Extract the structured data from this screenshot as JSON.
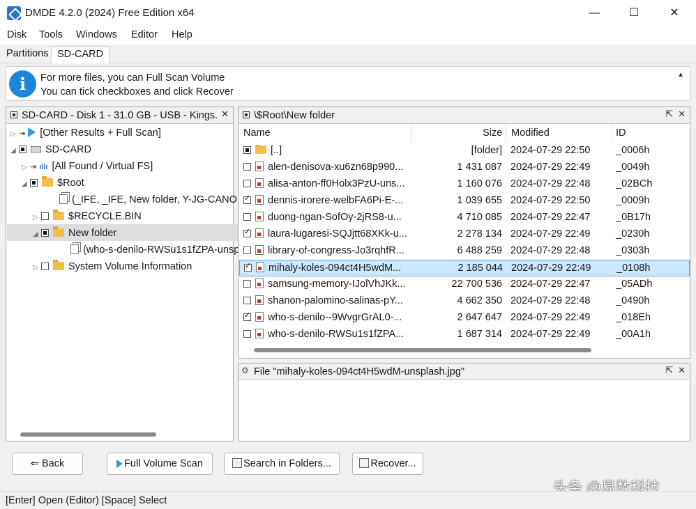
{
  "window": {
    "title": "DMDE 4.2.0 (2024) Free Edition x64",
    "controls": {
      "minimize": "—",
      "maximize": "☐",
      "close": "✕"
    }
  },
  "menu": [
    "Disk",
    "Tools",
    "Windows",
    "Editor",
    "Help"
  ],
  "tabs": [
    {
      "label": "Partitions",
      "active": false
    },
    {
      "label": "SD-CARD",
      "active": true
    }
  ],
  "info": {
    "line1": "For more files, you can Full Scan Volume",
    "line2": "You can tick checkboxes and click Recover",
    "icon": "i"
  },
  "tree_panel": {
    "title": "SD-CARD - Disk 1 - 31.0 GB - USB - Kings...",
    "items": [
      {
        "label": "[Other Results + Full Scan]",
        "icon": "play-icon"
      },
      {
        "label": "SD-CARD",
        "icon": "drive-icon"
      },
      {
        "label": "[All Found / Virtual FS]",
        "icon": "virtual-fs-icon"
      },
      {
        "label": "$Root",
        "icon": "folder-icon"
      },
      {
        "label": "(_IFE, _IFE, New folder, Y-JG-CANON",
        "icon": "copy-icon"
      },
      {
        "label": "$RECYCLE.BIN",
        "icon": "folder-icon"
      },
      {
        "label": "New folder",
        "icon": "folder-icon",
        "selected": true
      },
      {
        "label": "(who-s-denilo-RWSu1s1fZPA-unsp",
        "icon": "copy-icon"
      },
      {
        "label": "System Volume Information",
        "icon": "folder-icon"
      }
    ]
  },
  "file_panel": {
    "path": "\\$Root\\New folder",
    "columns": {
      "name": "Name",
      "size": "Size",
      "modified": "Modified",
      "id": "ID"
    },
    "rows": [
      {
        "name": "[..]",
        "size": "[folder]",
        "modified": "2024-07-29 22:50",
        "id": "_0006h",
        "check": "partial",
        "icon": "folder-icon"
      },
      {
        "name": "alen-denisova-xu6zn68p990...",
        "size": "1 431 087",
        "modified": "2024-07-29 22:49",
        "id": "_0049h",
        "check": "none",
        "icon": "image-file-icon"
      },
      {
        "name": "alisa-anton-ff0Holx3PzU-uns...",
        "size": "1 160 076",
        "modified": "2024-07-29 22:48",
        "id": "_02BCh",
        "check": "none",
        "icon": "image-file-icon"
      },
      {
        "name": "dennis-irorere-welbFA6Pi-E-...",
        "size": "1 039 655",
        "modified": "2024-07-29 22:50",
        "id": "_0009h",
        "check": "checked",
        "icon": "image-file-icon"
      },
      {
        "name": "duong-ngan-SofOy-2jRS8-u...",
        "size": "4 710 085",
        "modified": "2024-07-29 22:47",
        "id": "_0B17h",
        "check": "none",
        "icon": "image-file-icon"
      },
      {
        "name": "laura-lugaresi-SQJjtt68XKk-u...",
        "size": "2 278 134",
        "modified": "2024-07-29 22:49",
        "id": "_0230h",
        "check": "checked",
        "icon": "image-file-icon"
      },
      {
        "name": "library-of-congress-Jo3rqhfR...",
        "size": "6 488 259",
        "modified": "2024-07-29 22:48",
        "id": "_0303h",
        "check": "none",
        "icon": "image-file-icon"
      },
      {
        "name": "mihaly-koles-094ct4H5wdM...",
        "size": "2 185 044",
        "modified": "2024-07-29 22:49",
        "id": "_0108h",
        "check": "checked",
        "icon": "image-file-icon",
        "selected": true
      },
      {
        "name": "samsung-memory-IJolVhJKk...",
        "size": "22 700 536",
        "modified": "2024-07-29 22:47",
        "id": "_05ADh",
        "check": "none",
        "icon": "image-file-icon"
      },
      {
        "name": "shanon-palomino-salinas-pY...",
        "size": "4 662 350",
        "modified": "2024-07-29 22:48",
        "id": "_0490h",
        "check": "none",
        "icon": "image-file-icon"
      },
      {
        "name": "who-s-denilo--9WvgrGrAL0-...",
        "size": "2 647 647",
        "modified": "2024-07-29 22:49",
        "id": "_018Eh",
        "check": "checked",
        "icon": "image-file-icon"
      },
      {
        "name": "who-s-denilo-RWSu1s1fZPA...",
        "size": "1 687 314",
        "modified": "2024-07-29 22:49",
        "id": "_00A1h",
        "check": "none",
        "icon": "image-file-icon"
      }
    ]
  },
  "preview_panel": {
    "title": "File \"mihaly-koles-094ct4H5wdM-unsplash.jpg\""
  },
  "panel_buttons": {
    "popout": "⇱",
    "close": "✕"
  },
  "buttons": {
    "back": "Back",
    "full_scan": "Full Volume Scan",
    "search": "Search in Folders...",
    "recover": "Recover..."
  },
  "status": "[Enter] Open (Editor)  [Space] Select",
  "watermark": "头条 @易数科技"
}
